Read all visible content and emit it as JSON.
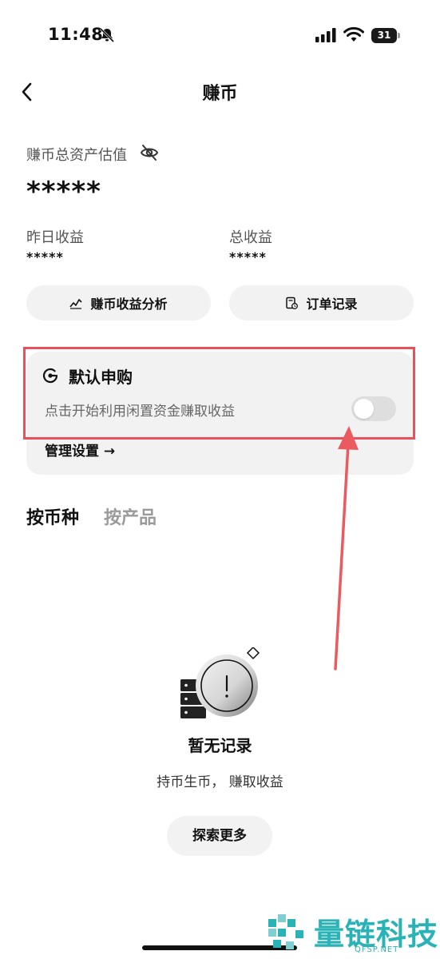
{
  "status_bar": {
    "time": "11:48",
    "battery": "31"
  },
  "nav": {
    "title": "赚币"
  },
  "assets": {
    "label": "赚币总资产估值",
    "value": "*****",
    "yesterday_label": "昨日收益",
    "yesterday_value": "*****",
    "total_label": "总收益",
    "total_value": "*****"
  },
  "actions": {
    "analysis": "赚币收益分析",
    "orders": "订单记录"
  },
  "default_subscribe": {
    "title": "默认申购",
    "description": "点击开始利用闲置资金赚取收益",
    "toggle_on": false,
    "manage": "管理设置 →"
  },
  "tabs": {
    "by_coin": "按币种",
    "by_product": "按产品"
  },
  "empty_state": {
    "title": "暂无记录",
    "description": "持币生币， 赚取收益",
    "button": "探索更多"
  },
  "watermark": {
    "text": "量链科技",
    "sub": "QFSP.NET"
  },
  "colors": {
    "annotation": "#e8505b",
    "card_bg": "#f2f2f2",
    "watermark": "#2ab3b7"
  }
}
